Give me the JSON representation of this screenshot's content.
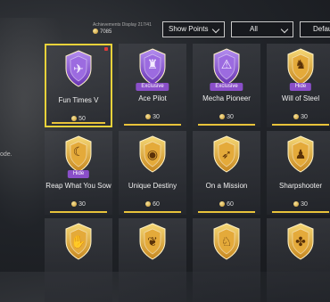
{
  "header": {
    "achievements_label": "Achievements Display 217/41",
    "points": "7085"
  },
  "filters": {
    "sort_label": "Show Points",
    "category_label": "All",
    "third_label": "Defau"
  },
  "side_text": "ode.",
  "colors": {
    "gold": "#e8c33a",
    "purple": "#8a4fc9",
    "selected": "#e8d23a"
  },
  "cards": [
    {
      "name": "Fun Times V",
      "points": "50",
      "tag": "",
      "selected": true,
      "emblem": "purple",
      "icon": "plane-icon"
    },
    {
      "name": "Ace Pilot",
      "points": "30",
      "tag": "Exclusive",
      "selected": false,
      "emblem": "purple",
      "icon": "mech-icon"
    },
    {
      "name": "Mecha Pioneer",
      "points": "30",
      "tag": "Exclusive",
      "selected": false,
      "emblem": "purple",
      "icon": "warning-icon"
    },
    {
      "name": "Will of Steel",
      "points": "30",
      "tag": "Hide",
      "selected": false,
      "emblem": "gold",
      "icon": "warrior-icon"
    },
    {
      "name": "Reap What You Sow",
      "points": "30",
      "tag": "Hide",
      "selected": false,
      "emblem": "gold",
      "icon": "scythe-icon"
    },
    {
      "name": "Unique Destiny",
      "points": "60",
      "tag": "",
      "selected": false,
      "emblem": "gold",
      "icon": "eye-icon"
    },
    {
      "name": "On a Mission",
      "points": "60",
      "tag": "",
      "selected": false,
      "emblem": "gold",
      "icon": "bow-icon"
    },
    {
      "name": "Sharpshooter",
      "points": "30",
      "tag": "",
      "selected": false,
      "emblem": "gold",
      "icon": "soldier-icon"
    },
    {
      "name": "",
      "points": "",
      "tag": "",
      "selected": false,
      "emblem": "gold",
      "icon": "hand-icon"
    },
    {
      "name": "",
      "points": "",
      "tag": "",
      "selected": false,
      "emblem": "gold",
      "icon": "bird-icon"
    },
    {
      "name": "",
      "points": "",
      "tag": "",
      "selected": false,
      "emblem": "gold",
      "icon": "horse-icon"
    },
    {
      "name": "",
      "points": "",
      "tag": "",
      "selected": false,
      "emblem": "gold",
      "icon": "clover-icon"
    }
  ]
}
